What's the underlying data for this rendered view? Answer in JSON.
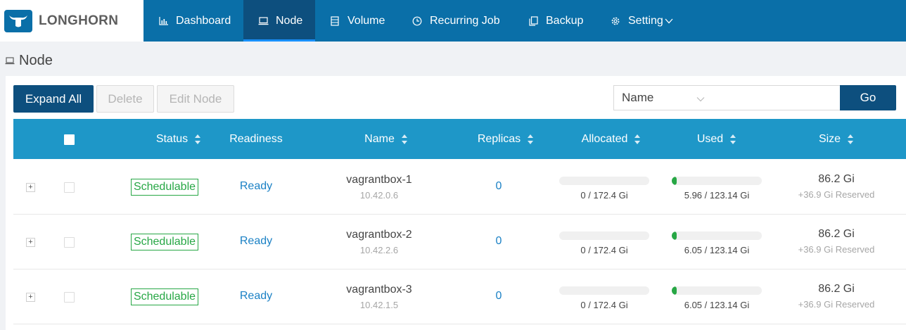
{
  "brand": {
    "name": "LONGHORN",
    "logo_icon": "longhorn-logo-icon"
  },
  "nav": {
    "items": [
      {
        "label": "Dashboard",
        "icon": "bar-chart-icon"
      },
      {
        "label": "Node",
        "icon": "laptop-icon",
        "active": true
      },
      {
        "label": "Volume",
        "icon": "database-icon"
      },
      {
        "label": "Recurring Job",
        "icon": "clock-icon"
      },
      {
        "label": "Backup",
        "icon": "copy-icon"
      },
      {
        "label": "Setting",
        "icon": "gear-icon"
      }
    ]
  },
  "page": {
    "title": "Node",
    "title_icon": "laptop-icon"
  },
  "toolbar": {
    "expand_all": "Expand All",
    "delete": "Delete",
    "edit_node": "Edit Node",
    "search_field": "Name",
    "search_value": "",
    "go": "Go"
  },
  "table": {
    "columns": [
      "Status",
      "Readiness",
      "Name",
      "Replicas",
      "Allocated",
      "Used",
      "Size"
    ],
    "rows": [
      {
        "status": "Schedulable",
        "readiness": "Ready",
        "name": "vagrantbox-1",
        "ip": "10.42.0.6",
        "replicas": "0",
        "allocated": "0 / 172.4 Gi",
        "allocated_fraction": 0.0,
        "used": "5.96 / 123.14 Gi",
        "used_fraction": 0.048,
        "size": "86.2 Gi",
        "reserved": "+36.9 Gi Reserved"
      },
      {
        "status": "Schedulable",
        "readiness": "Ready",
        "name": "vagrantbox-2",
        "ip": "10.42.2.6",
        "replicas": "0",
        "allocated": "0 / 172.4 Gi",
        "allocated_fraction": 0.0,
        "used": "6.05 / 123.14 Gi",
        "used_fraction": 0.049,
        "size": "86.2 Gi",
        "reserved": "+36.9 Gi Reserved"
      },
      {
        "status": "Schedulable",
        "readiness": "Ready",
        "name": "vagrantbox-3",
        "ip": "10.42.1.5",
        "replicas": "0",
        "allocated": "0 / 172.4 Gi",
        "allocated_fraction": 0.0,
        "used": "6.05 / 123.14 Gi",
        "used_fraction": 0.049,
        "size": "86.2 Gi",
        "reserved": "+36.9 Gi Reserved"
      }
    ]
  },
  "colors": {
    "header_bg": "#0a6fa8",
    "active_nav": "#0d4f7e",
    "table_header": "#1e97c8",
    "schedulable": "#27a745",
    "link": "#1b81c5"
  }
}
